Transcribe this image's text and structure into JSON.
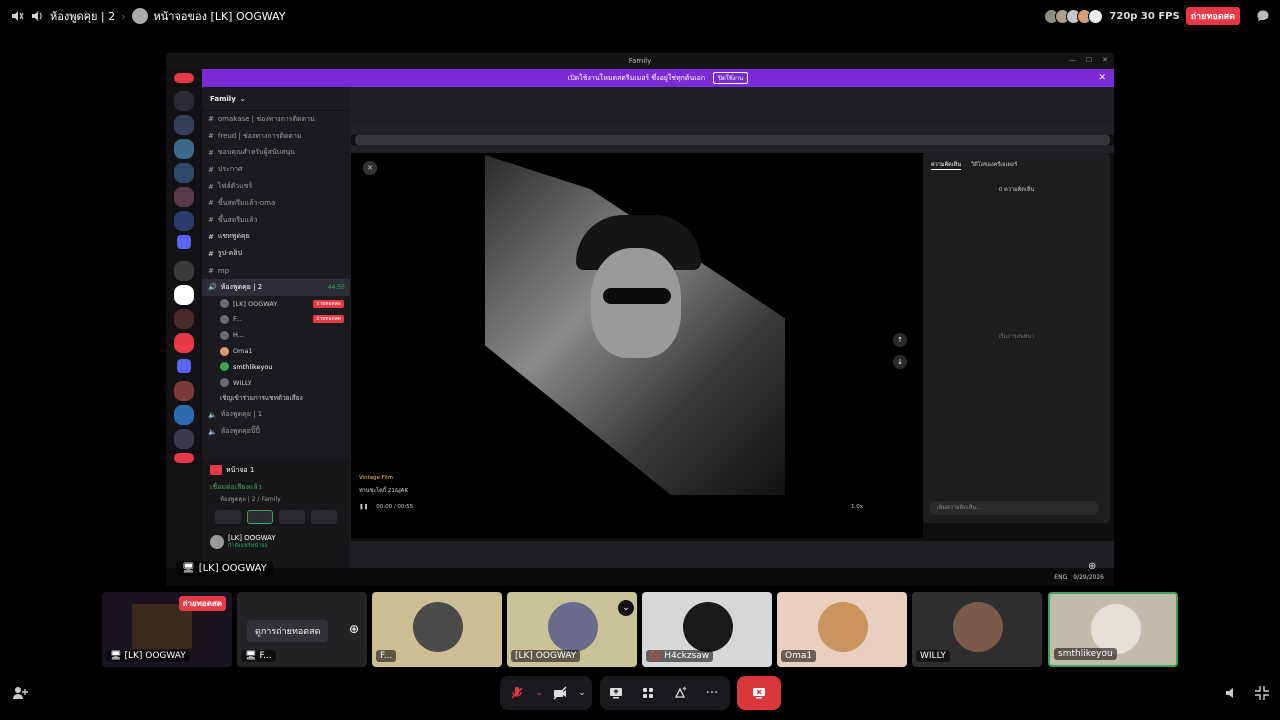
{
  "topbar": {
    "channel_name": "ห้องพูดคุย | 2",
    "stream_title": "หน้าจอของ [LK] OOGWAY",
    "quality": "720p 30 FPS",
    "live_badge": "ถ่ายทอดสด"
  },
  "stage": {
    "window_title": "Family",
    "banner_text": "เปิดใช้งานโหมดสตรีมเมอร์ ซึ่งอยู่ใช่ทุกต้นเอก",
    "banner_button": "ปิดใช้งาน",
    "server_name": "Family",
    "channels": [
      {
        "name": "omakase | ช่องทางการติดตาม",
        "active": false
      },
      {
        "name": "freud | ช่องทางการติดตาม",
        "active": false
      },
      {
        "name": "ขอบคุณสำหรับผู้สนับสนุน",
        "active": false
      },
      {
        "name": "ประกาศ",
        "active": false
      },
      {
        "name": "ไฟล์ตัวแชร์",
        "active": false
      },
      {
        "name": "ขึ้นสตรีมแล้ว-oma",
        "active": false
      },
      {
        "name": "ขึ้นสตรีมแล้ว",
        "active": false
      },
      {
        "name": "แชทพูดคุย",
        "active": false
      },
      {
        "name": "รูป-คลิป",
        "active": false
      },
      {
        "name": "mp",
        "active": false
      }
    ],
    "voice_channel": "ห้องพูดคุย | 2",
    "voice_time": "44:55",
    "voice_users": [
      {
        "name": "[LK] OOGWAY",
        "live": "ถ่ายทอดสด"
      },
      {
        "name": "F...",
        "live": "ถ่ายทอดสด"
      },
      {
        "name": "H...",
        "live": ""
      },
      {
        "name": "Oma1",
        "live": ""
      },
      {
        "name": "smthlikeyou",
        "live": ""
      },
      {
        "name": "WILLY",
        "live": ""
      }
    ],
    "invite_text": "เชิญเข้าร่วมการแชทด้วยเสียง",
    "other_voice_1": "ห้องพูดคุย | 1",
    "other_voice_2": "ห้องพูดคุยปิ๊ปี้",
    "stream_panel_title": "หน้าจอ 1",
    "connected_text": "เชื่อมต่อเสียงแล้ว",
    "connected_sub": "ห้องพูดคุย | 2 / Family",
    "user_name": "[LK] OOGWAY",
    "user_status": "กำลังแชร์หน้าจอ",
    "video_tag": "Vintage Film",
    "video_author": "ท่านชะโคกี้ 21&JAK",
    "video_time": "00:00 / 00:55",
    "video_speed": "1.0x",
    "comments_tab_1": "ความคิดเห็น",
    "comments_tab_2": "วิดีโอของครีเอเตอร์",
    "comments_count": "0 ความคิดเห็น",
    "comments_empty": "เริ่มการสนทนา",
    "comments_placeholder": "เพิ่มความคิดเห็น...",
    "lang": "ENG",
    "date": "9/29/2026",
    "label": "[LK] OOGWAY"
  },
  "thumbnails": [
    {
      "name": "[LK] OOGWAY",
      "live": "ถ่ายทอดสด",
      "kind": "screen"
    },
    {
      "name": "F...",
      "watch_button": "ดูการถ่ายทอดสด",
      "kind": "screen"
    },
    {
      "name": "F...",
      "kind": "avatar",
      "bg": "#cbbf93"
    },
    {
      "name": "[LK] OOGWAY",
      "kind": "avatar",
      "bg": "#c9c398"
    },
    {
      "name": "H4ckzsaw",
      "kind": "avatar",
      "bg": "#d7d7d7",
      "muted": true
    },
    {
      "name": "Oma1",
      "kind": "avatar",
      "bg": "#e9cfbf"
    },
    {
      "name": "WILLY",
      "kind": "avatar",
      "bg": "#2e2e2e"
    },
    {
      "name": "smthlikeyou",
      "kind": "avatar",
      "bg": "#c2bcad",
      "speaking": true
    }
  ],
  "colors": {
    "live_red": "#e63946",
    "speaking_green": "#3ba55c",
    "end_call": "#da373c",
    "banner_purple": "#7b2bd6"
  }
}
